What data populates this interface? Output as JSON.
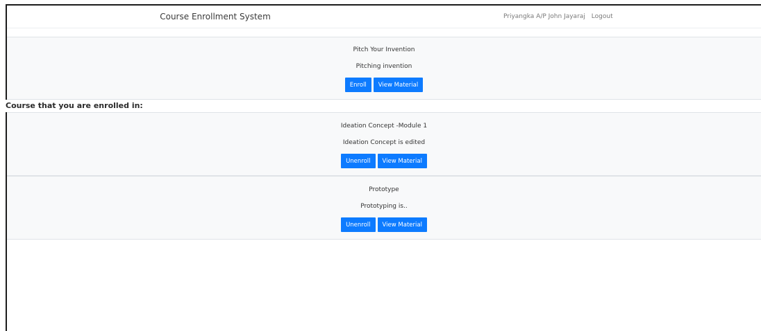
{
  "navbar": {
    "brand": "Course Enrollment System",
    "user_name": "Priyangka A/P John Jayaraj",
    "logout_label": "Logout"
  },
  "available_courses": [
    {
      "title": "Pitch Your Invention",
      "description": "Pitching invention",
      "primary_label": "Enroll",
      "secondary_label": "View Material"
    }
  ],
  "enrolled_heading": "Course that you are enrolled in:",
  "enrolled_courses": [
    {
      "title": "Ideation Concept -Module 1",
      "description": "Ideation Concept is edited",
      "primary_label": "Unenroll",
      "secondary_label": "View Material"
    },
    {
      "title": "Prototype",
      "description": "Prototyping is..",
      "primary_label": "Unenroll",
      "secondary_label": "View Material"
    }
  ],
  "colors": {
    "button": "#0d7bff",
    "card_background": "#f8f9fa",
    "page_background": "#ffffff"
  }
}
